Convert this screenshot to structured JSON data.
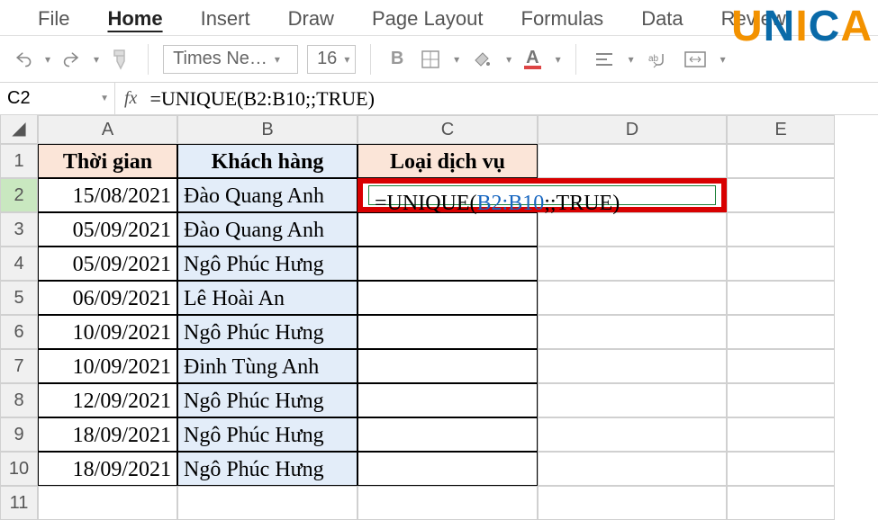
{
  "ribbon": {
    "tabs": [
      "File",
      "Home",
      "Insert",
      "Draw",
      "Page Layout",
      "Formulas",
      "Data",
      "Review"
    ],
    "activeTab": "Home"
  },
  "toolbar": {
    "font": "Times Ne…",
    "size": "16"
  },
  "formulaBar": {
    "nameBox": "C2",
    "fx": "fx",
    "formula": "=UNIQUE(B2:B10;;TRUE)"
  },
  "watermark": {
    "u": "U",
    "n": "N",
    "i": "I",
    "c": "C",
    "a": "A"
  },
  "columns": [
    "A",
    "B",
    "C",
    "D",
    "E"
  ],
  "headers": {
    "A": "Thời gian",
    "B": "Khách hàng",
    "C": "Loại dịch vụ"
  },
  "cellC2": {
    "pre": "=UNIQUE(",
    "ref": "B2:B10",
    "post": ";;TRUE)"
  },
  "rows": [
    {
      "n": "1"
    },
    {
      "n": "2",
      "A": "15/08/2021",
      "B": "Đào Quang Anh"
    },
    {
      "n": "3",
      "A": "05/09/2021",
      "B": "Đào Quang Anh"
    },
    {
      "n": "4",
      "A": "05/09/2021",
      "B": "Ngô Phúc Hưng"
    },
    {
      "n": "5",
      "A": "06/09/2021",
      "B": "Lê Hoài An"
    },
    {
      "n": "6",
      "A": "10/09/2021",
      "B": "Ngô Phúc Hưng"
    },
    {
      "n": "7",
      "A": "10/09/2021",
      "B": "Đinh Tùng Anh"
    },
    {
      "n": "8",
      "A": "12/09/2021",
      "B": "Ngô Phúc Hưng"
    },
    {
      "n": "9",
      "A": "18/09/2021",
      "B": "Ngô Phúc Hưng"
    },
    {
      "n": "10",
      "A": "18/09/2021",
      "B": "Ngô Phúc Hưng"
    },
    {
      "n": "11"
    }
  ]
}
